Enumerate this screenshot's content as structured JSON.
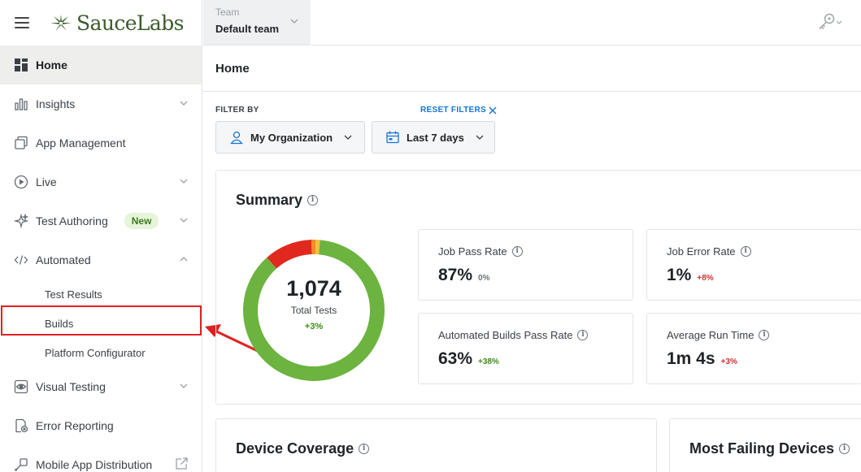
{
  "app": {
    "brand": "SauceLabs"
  },
  "team": {
    "label": "Team",
    "value": "Default team"
  },
  "sidebar": {
    "items": [
      {
        "label": "Home"
      },
      {
        "label": "Insights"
      },
      {
        "label": "App Management"
      },
      {
        "label": "Live"
      },
      {
        "label": "Test Authoring",
        "badge": "New"
      },
      {
        "label": "Automated"
      },
      {
        "label": "Visual Testing"
      },
      {
        "label": "Error Reporting"
      },
      {
        "label": "Mobile App Distribution"
      }
    ],
    "automated_subitems": [
      {
        "label": "Test Results"
      },
      {
        "label": "Builds"
      },
      {
        "label": "Platform Configurator"
      }
    ]
  },
  "page": {
    "title": "Home"
  },
  "filters": {
    "label": "FILTER BY",
    "reset_label": "RESET FILTERS",
    "organization": "My Organization",
    "date_range": "Last 7 days"
  },
  "summary": {
    "title": "Summary",
    "total_tests": "1,074",
    "total_label": "Total Tests",
    "total_delta": "+3%",
    "donut_segments": [
      {
        "name": "passed",
        "fraction": 0.87,
        "color": "#6db33f"
      },
      {
        "name": "failed",
        "fraction": 0.11,
        "color": "#e0281f"
      },
      {
        "name": "error",
        "fraction": 0.01,
        "color": "#f28c28"
      },
      {
        "name": "other",
        "fraction": 0.01,
        "color": "#f3c13a"
      }
    ],
    "metrics": [
      {
        "title": "Job Pass Rate",
        "value": "87%",
        "delta": "0%"
      },
      {
        "title": "Job Error Rate",
        "value": "1%",
        "delta": "+8%"
      },
      {
        "title": "Automated Builds Pass Rate",
        "value": "63%",
        "delta": "+38%"
      },
      {
        "title": "Average Run Time",
        "value": "1m 4s",
        "delta": "+3%"
      }
    ]
  },
  "device_coverage": {
    "title": "Device Coverage"
  },
  "most_failing": {
    "title": "Most Failing Devices"
  },
  "colors": {
    "accent": "#1673d2",
    "brand": "#3b5b2a",
    "highlight": "#e02020"
  }
}
